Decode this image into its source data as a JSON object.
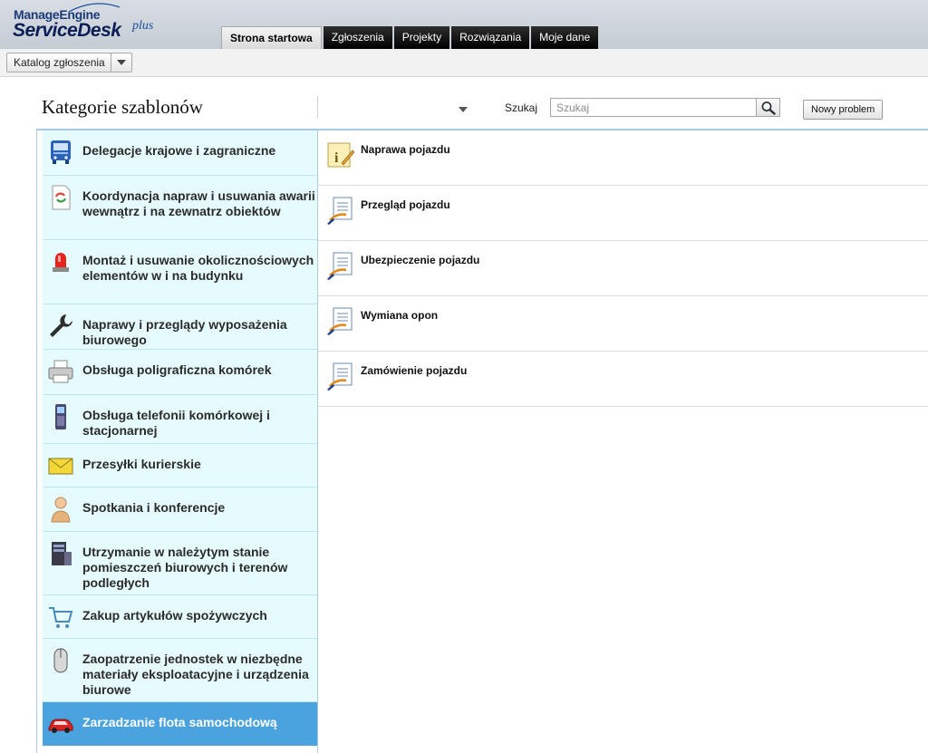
{
  "brand": {
    "line1": "ManageEngine",
    "line2": "ServiceDesk",
    "line3": "plus"
  },
  "tabs": [
    {
      "label": "Strona startowa",
      "active": true
    },
    {
      "label": "Zgłoszenia"
    },
    {
      "label": "Projekty"
    },
    {
      "label": "Rozwiązania"
    },
    {
      "label": "Moje dane"
    }
  ],
  "toolbar": {
    "catalog_label": "Katalog zgłoszenia"
  },
  "page": {
    "title": "Kategorie szablonów"
  },
  "search": {
    "label": "Szukaj",
    "placeholder": "Szukaj",
    "value": ""
  },
  "actions": {
    "new_problem": "Nowy problem"
  },
  "categories": [
    {
      "label": "Delegacje krajowe i zagraniczne",
      "icon": "bus-icon"
    },
    {
      "label": "Koordynacja napraw i usuwania awarii wewnątrz i na zewnatrz obiektów",
      "icon": "refresh-document-icon"
    },
    {
      "label": "Montaż i usuwanie okolicznościowych elementów w i na budynku",
      "icon": "siren-icon"
    },
    {
      "label": "Naprawy i przeglądy wyposażenia biurowego",
      "icon": "wrench-icon"
    },
    {
      "label": "Obsługa poligraficzna komórek",
      "icon": "printer-icon"
    },
    {
      "label": "Obsługa telefonii komórkowej i stacjonarnej",
      "icon": "mobile-phone-icon"
    },
    {
      "label": "Przesyłki kurierskie",
      "icon": "envelope-icon"
    },
    {
      "label": "Spotkania i konferencje",
      "icon": "person-icon"
    },
    {
      "label": "Utrzymanie w należytym stanie pomieszczeń biurowych i terenów podległych",
      "icon": "server-icon"
    },
    {
      "label": "Zakup artykułów spożywczych",
      "icon": "shopping-cart-icon"
    },
    {
      "label": "Zaopatrzenie jednostek w niezbędne materiały eksploatacyjne i urządzenia biurowe",
      "icon": "mouse-icon"
    },
    {
      "label": "Zarzadzanie flota samochodową",
      "icon": "car-icon",
      "selected": true
    }
  ],
  "templates": [
    {
      "label": "Naprawa pojazdu",
      "icon": "info-note-icon"
    },
    {
      "label": "Przegląd pojazdu",
      "icon": "document-pen-icon"
    },
    {
      "label": "Ubezpieczenie pojazdu",
      "icon": "document-pen-icon"
    },
    {
      "label": "Wymiana opon",
      "icon": "document-pen-icon"
    },
    {
      "label": "Zamówienie pojazdu",
      "icon": "document-pen-icon"
    }
  ],
  "colors": {
    "selected_bg": "#4aa3df",
    "category_bg": "#e6fbfd",
    "panel_border": "#a9cbe6"
  }
}
